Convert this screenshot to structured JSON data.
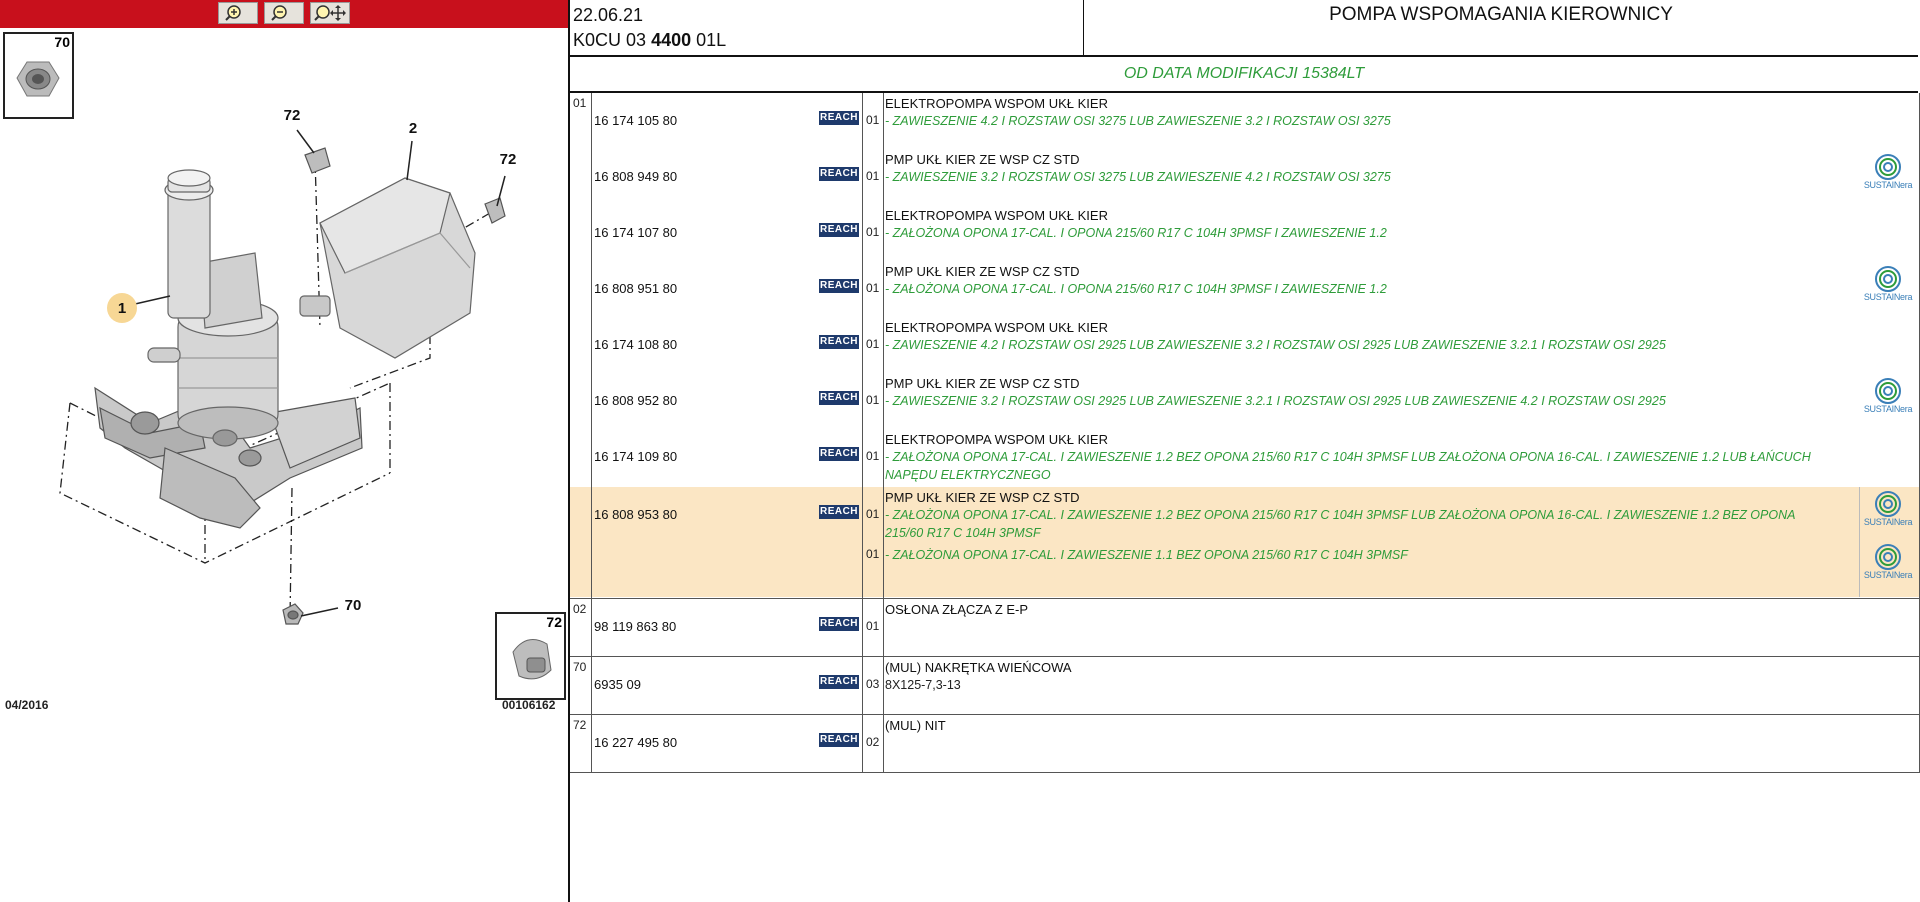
{
  "viewer": {
    "toolbar": {
      "zoom_in": "zoom-in",
      "zoom_out": "zoom-out",
      "zoom_pan": "zoom-pan"
    },
    "date": "04/2016",
    "ref_code": "00106162",
    "thumb_top": "70",
    "thumb_bottom": "72",
    "callouts": {
      "c1": "1",
      "c2": "2",
      "c72a": "72",
      "c72b": "72",
      "c70": "70"
    }
  },
  "header": {
    "date": "22.06.21",
    "code_prefix": "K0CU 03",
    "code_bold": "4400",
    "code_suffix": "01L",
    "title": "POMPA WSPOMAGANIA KIEROWNICY"
  },
  "modification": "OD DATA MODIFIKACJI 15384LT",
  "reach_label": "REACH",
  "sustain": {
    "label": "SUSTAINera",
    "color": "#3a7fb8"
  },
  "colors": {
    "toolbar": "#c8101c",
    "highlight": "#fbe6c4",
    "condition": "#2e9c3a",
    "reach": "#1e3a6c"
  },
  "groups": [
    {
      "ref": "01",
      "rows": [
        {
          "part": "16 174 105 80",
          "qty": "01",
          "title": "ELEKTROPOMPA WSPOM UKŁ KIER",
          "conds": [
            "- ZAWIESZENIE 4.2 I ROZSTAW OSI 3275 LUB ZAWIESZENIE 3.2 I ROZSTAW OSI 3275"
          ],
          "sustain": false
        },
        {
          "part": "16 808 949 80",
          "qty": "01",
          "title": "PMP UKŁ KIER ZE WSP CZ STD",
          "conds": [
            "- ZAWIESZENIE 3.2 I ROZSTAW OSI 3275 LUB ZAWIESZENIE 4.2 I ROZSTAW OSI 3275"
          ],
          "sustain": true
        },
        {
          "part": "16 174 107 80",
          "qty": "01",
          "title": "ELEKTROPOMPA WSPOM UKŁ KIER",
          "conds": [
            "- ZAŁOŻONA OPONA 17-CAL. I OPONA 215/60 R17 C 104H 3PMSF I ZAWIESZENIE 1.2"
          ],
          "sustain": false
        },
        {
          "part": "16 808 951 80",
          "qty": "01",
          "title": "PMP UKŁ KIER ZE WSP CZ STD",
          "conds": [
            "- ZAŁOŻONA OPONA 17-CAL. I OPONA 215/60 R17 C 104H 3PMSF I ZAWIESZENIE 1.2"
          ],
          "sustain": true
        },
        {
          "part": "16 174 108 80",
          "qty": "01",
          "title": "ELEKTROPOMPA WSPOM UKŁ KIER",
          "conds": [
            "- ZAWIESZENIE 4.2 I ROZSTAW OSI 2925 LUB ZAWIESZENIE 3.2 I ROZSTAW OSI 2925 LUB ZAWIESZENIE 3.2.1 I ROZSTAW OSI 2925"
          ],
          "sustain": false
        },
        {
          "part": "16 808 952 80",
          "qty": "01",
          "title": "PMP UKŁ KIER ZE WSP CZ STD",
          "conds": [
            "- ZAWIESZENIE 3.2 I ROZSTAW OSI 2925 LUB ZAWIESZENIE 3.2.1 I ROZSTAW OSI 2925 LUB ZAWIESZENIE 4.2 I ROZSTAW OSI 2925"
          ],
          "sustain": true
        },
        {
          "part": "16 174 109 80",
          "qty": "01",
          "title": "ELEKTROPOMPA WSPOM UKŁ KIER",
          "conds": [
            "- ZAŁOŻONA OPONA 17-CAL. I ZAWIESZENIE 1.2 BEZ OPONA 215/60 R17 C 104H 3PMSF LUB ZAŁOŻONA OPONA 16-CAL. I ZAWIESZENIE 1.2 LUB ŁAŃCUCH NAPĘDU ELEKTRYCZNEGO"
          ],
          "sustain": false
        },
        {
          "part": "16 808 953 80",
          "qty": "01",
          "title": "PMP UKŁ KIER ZE WSP CZ STD",
          "conds": [
            "- ZAŁOŻONA OPONA 17-CAL. I ZAWIESZENIE 1.2 BEZ OPONA 215/60 R17 C 104H 3PMSF LUB ZAŁOŻONA OPONA 16-CAL. I ZAWIESZENIE 1.2 BEZ OPONA 215/60 R17 C 104H 3PMSF"
          ],
          "sustain": true,
          "highlight": true,
          "extra_qty": "01",
          "extra_cond": "- ZAŁOŻONA OPONA 17-CAL. I ZAWIESZENIE 1.1 BEZ OPONA 215/60 R17 C 104H 3PMSF",
          "extra_sustain": true
        }
      ]
    },
    {
      "ref": "02",
      "rows": [
        {
          "part": "98 119 863 80",
          "qty": "01",
          "title": "OSŁONA ZŁĄCZA Z E-P",
          "conds": [],
          "sustain": false
        }
      ]
    },
    {
      "ref": "70",
      "rows": [
        {
          "part": "6935 09",
          "qty": "03",
          "title": "(MUL) NAKRĘTKA WIEŃCOWA",
          "conds": [
            "8X125-7,3-13"
          ],
          "plain": true,
          "sustain": false
        }
      ]
    },
    {
      "ref": "72",
      "rows": [
        {
          "part": "16 227 495 80",
          "qty": "02",
          "title": "(MUL) NIT",
          "conds": [],
          "sustain": false
        }
      ]
    }
  ]
}
